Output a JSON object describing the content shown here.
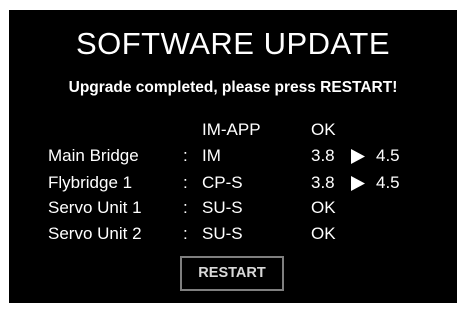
{
  "screen": {
    "title": "SOFTWARE UPDATE",
    "message": "Upgrade completed, please press RESTART!",
    "header": {
      "module": "IM-APP",
      "status": "OK"
    },
    "units": [
      {
        "name": "Main Bridge",
        "separator": ":",
        "module": "IM",
        "value": "3.8",
        "arrow_icon": "play-right-icon",
        "new_value": "4.5"
      },
      {
        "name": "Flybridge 1",
        "separator": ":",
        "module": "CP-S",
        "value": "3.8",
        "arrow_icon": "play-right-icon",
        "new_value": "4.5"
      },
      {
        "name": "Servo Unit 1",
        "separator": ":",
        "module": "SU-S",
        "value": "OK"
      },
      {
        "name": "Servo Unit 2",
        "separator": ":",
        "module": "SU-S",
        "value": "OK"
      }
    ],
    "restart_label": "RESTART"
  },
  "colors": {
    "background": "#000000",
    "text": "#ffffff",
    "button_border": "#7f7f7f",
    "button_text": "#d9d9d9"
  }
}
